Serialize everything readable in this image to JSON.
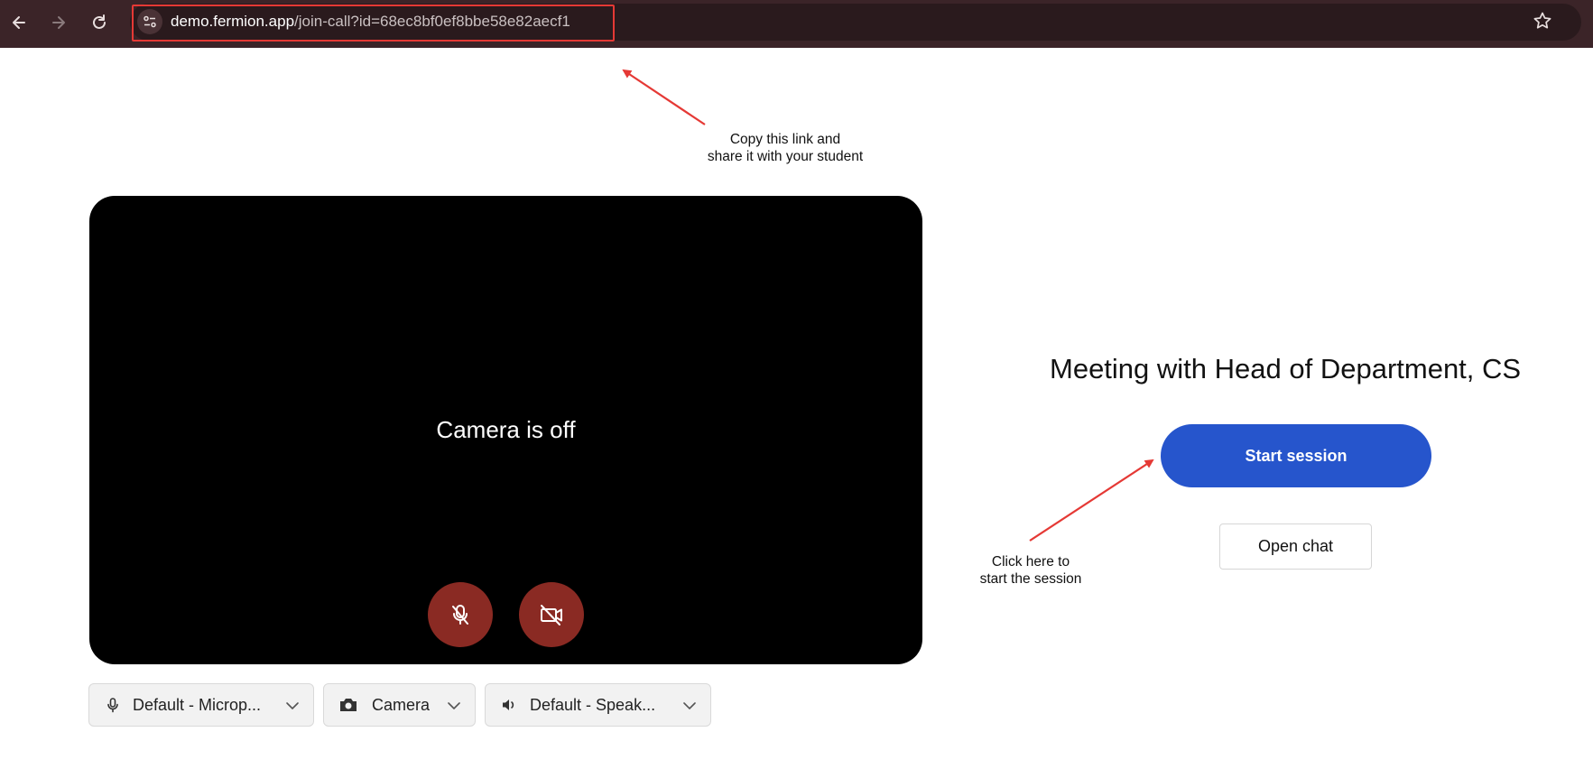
{
  "browser": {
    "url_domain": "demo.fermion.app",
    "url_path": "/join-call?id=68ec8bf0ef8bbe58e82aecf1",
    "icons": [
      "back-icon",
      "forward-icon",
      "reload-icon",
      "site-info-icon",
      "bookmark-star-icon"
    ]
  },
  "annotations": {
    "copy_link": [
      "Copy this link and",
      "share it with your student"
    ],
    "start_hint": [
      "Click here to",
      "start the session"
    ]
  },
  "video": {
    "status": "Camera is off",
    "mic_muted": true,
    "camera_off": true
  },
  "devices": {
    "microphone": "Default - Microp...",
    "camera": "Camera",
    "speaker": "Default - Speak..."
  },
  "meeting": {
    "title": "Meeting with Head of Department, CS",
    "start_button": "Start session",
    "chat_button": "Open chat"
  },
  "colors": {
    "browser_bar": "#3b2428",
    "primary_button": "#2655cc",
    "muted_control": "#8a2a23",
    "annotation_red": "#e53935"
  }
}
